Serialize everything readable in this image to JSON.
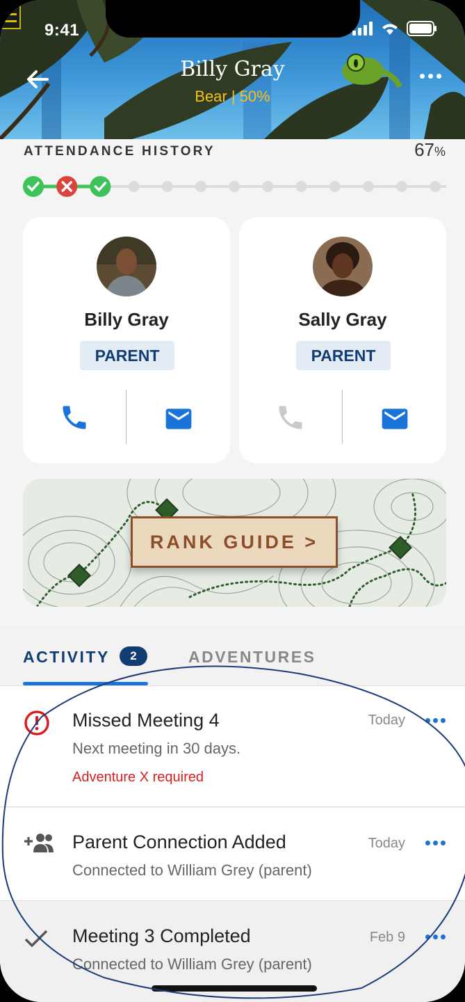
{
  "status": {
    "time": "9:41"
  },
  "header": {
    "title": "Billy Gray",
    "subtitle": "Bear | 50%"
  },
  "attendance": {
    "label": "ATTENDANCE HISTORY",
    "percent": "67",
    "percent_unit": "%",
    "marks": [
      "attended",
      "missed",
      "attended",
      "none",
      "none",
      "none",
      "none",
      "none",
      "none",
      "none",
      "none",
      "none",
      "none",
      "none",
      "none"
    ]
  },
  "contacts": [
    {
      "name": "Billy Gray",
      "role": "PARENT",
      "phone_enabled": true,
      "email_enabled": true
    },
    {
      "name": "Sally Gray",
      "role": "PARENT",
      "phone_enabled": false,
      "email_enabled": true
    }
  ],
  "rank_guide": {
    "label": "RANK GUIDE  >"
  },
  "tabs": {
    "activity": {
      "label": "ACTIVITY",
      "count": "2"
    },
    "adventures": {
      "label": "ADVENTURES"
    }
  },
  "activity_items": [
    {
      "icon": "alert-circle-icon",
      "title": "Missed Meeting 4",
      "subtitle": "Next meeting in 30 days.",
      "warning": "Adventure X required",
      "date": "Today"
    },
    {
      "icon": "add-group-icon",
      "title": "Parent Connection Added",
      "subtitle": "Connected to William Grey (parent)",
      "date": "Today"
    },
    {
      "icon": "checkmark-icon",
      "title": "Meeting 3 Completed",
      "subtitle": "Connected to William Grey (parent)",
      "date": "Feb 9"
    }
  ],
  "colors": {
    "primary": "#123d73",
    "accent": "#1a73d9",
    "attended": "#3ec25a",
    "missed": "#d9453d",
    "warning": "#d61f1f",
    "rank_brown": "#8a4f2a"
  }
}
